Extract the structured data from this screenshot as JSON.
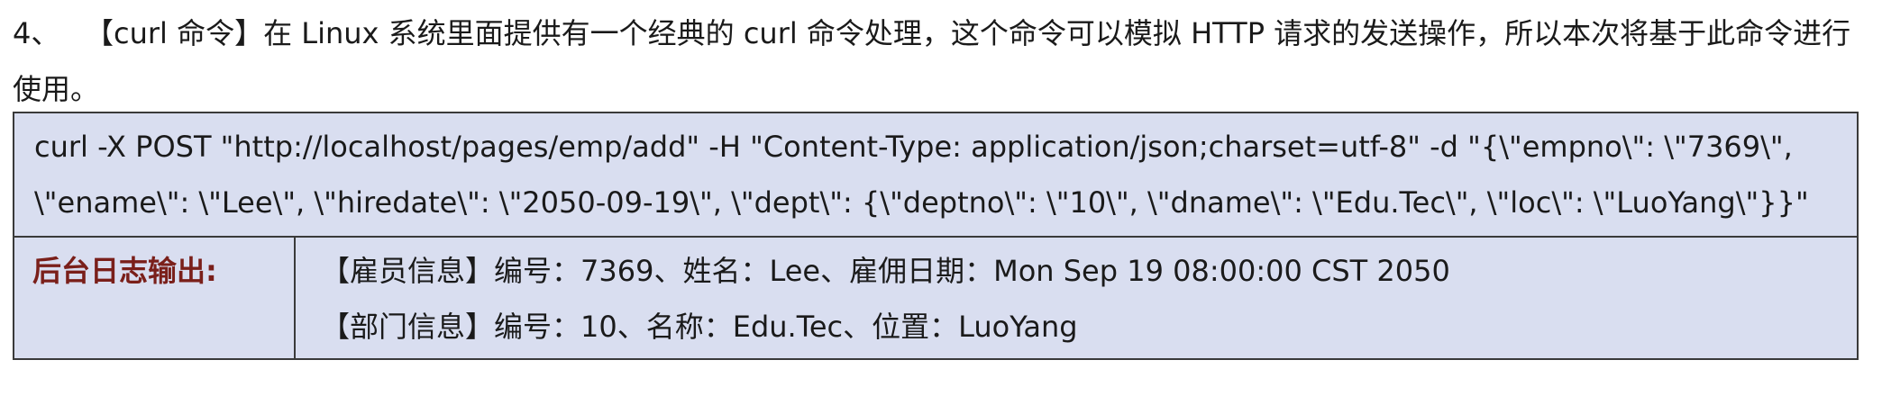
{
  "paragraph": {
    "number": "4、",
    "text": "【curl 命令】在 Linux 系统里面提供有一个经典的 curl 命令处理，这个命令可以模拟 HTTP 请求的发送操作，所以本次将基于此命令进行使用。"
  },
  "code": {
    "command": "curl -X POST \"http://localhost/pages/emp/add\" -H \"Content-Type: application/json;charset=utf-8\" -d \"{\\\"empno\\\": \\\"7369\\\", \\\"ename\\\": \\\"Lee\\\", \\\"hiredate\\\": \\\"2050-09-19\\\", \\\"dept\\\": {\\\"deptno\\\": \\\"10\\\", \\\"dname\\\": \\\"Edu.Tec\\\", \\\"loc\\\": \\\"LuoYang\\\"}}\""
  },
  "log": {
    "label": "后台日志输出:",
    "lines": [
      "【雇员信息】编号：7369、姓名：Lee、雇佣日期：Mon Sep 19 08:00:00 CST 2050",
      "【部门信息】编号：10、名称：Edu.Tec、位置：LuoYang"
    ]
  }
}
